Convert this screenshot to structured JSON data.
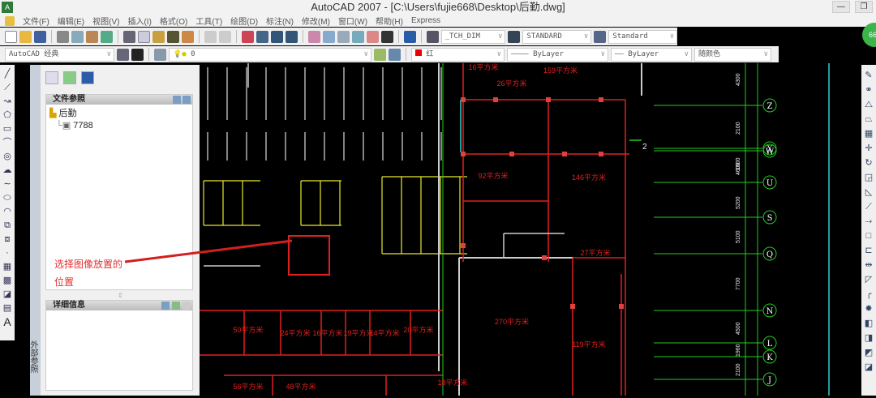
{
  "window": {
    "title": "AutoCAD 2007 - [C:\\Users\\fujie668\\Desktop\\后勤.dwg]",
    "minimize": "—",
    "restore": "❐"
  },
  "menu": [
    "文件(F)",
    "编辑(E)",
    "视图(V)",
    "插入(I)",
    "格式(O)",
    "工具(T)",
    "绘图(D)",
    "标注(N)",
    "修改(M)",
    "窗口(W)",
    "帮助(H)",
    "Express"
  ],
  "styles": {
    "text_style": "_TCH_DIM",
    "dim_style": "STANDARD",
    "table_style": "Standard"
  },
  "workspace": "AutoCAD 经典",
  "layer": "0",
  "properties": {
    "color": "红",
    "linetype": "ByLayer",
    "lineweight": "ByLayer",
    "plotstyle": "随颜色"
  },
  "accent_colors": {
    "cad_red": "#e02020",
    "cad_green": "#22cc22",
    "cad_yellow": "#e8e830",
    "cad_cyan": "#30d0d0"
  },
  "palette": {
    "vertical_title": "外部参照",
    "file_refs_header": "文件参照",
    "tree": [
      {
        "label": "后勤",
        "icon": "drawing-icon"
      },
      {
        "label": "7788",
        "icon": "image-icon"
      }
    ],
    "details_header": "详细信息",
    "annotation": [
      "选择图像放置的",
      "位置"
    ]
  },
  "rooms": [
    {
      "name": "16平方米"
    },
    {
      "name": "26平方米"
    },
    {
      "name": "159平方米"
    },
    {
      "name": "92平方米"
    },
    {
      "name": "146平方米"
    },
    {
      "name": "27平方米"
    },
    {
      "name": "270平方米"
    },
    {
      "name": "119平方米"
    },
    {
      "name": "50平方米"
    },
    {
      "name": "24平方米"
    },
    {
      "name": "16平方米"
    },
    {
      "name": "19平方米"
    },
    {
      "name": "14平方米"
    },
    {
      "name": "20平方米"
    },
    {
      "name": "56平方米"
    },
    {
      "name": "48平方米"
    },
    {
      "name": "18平方米"
    }
  ],
  "axes": [
    "Z",
    "X",
    "W",
    "U",
    "S",
    "Q",
    "N",
    "L",
    "K",
    "J"
  ],
  "dims": [
    "4300",
    "2100",
    "1600",
    "4600",
    "5200",
    "5100",
    "7700",
    "4500",
    "1960",
    "2100"
  ],
  "section_mark": "2"
}
